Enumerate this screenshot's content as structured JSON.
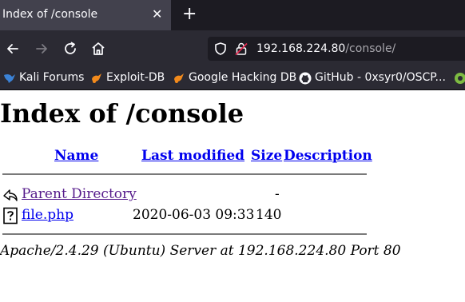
{
  "browser": {
    "tab_title": "Index of /console",
    "tab_close": "✕",
    "new_tab": "+",
    "url": {
      "host": "192.168.224.80",
      "path": "/console/"
    },
    "bookmarks": [
      {
        "label": "Kali Forums",
        "icon": "kali-icon"
      },
      {
        "label": "Exploit-DB",
        "icon": "exploit-db-icon"
      },
      {
        "label": "Google Hacking DB",
        "icon": "exploit-db-icon"
      },
      {
        "label": "GitHub - 0xsyr0/OSCP...",
        "icon": "github-icon"
      }
    ]
  },
  "page": {
    "heading": "Index of /console",
    "columns": {
      "name": "Name",
      "last_modified": "Last modified",
      "size": "Size",
      "description": "Description"
    },
    "rows": [
      {
        "name": "Parent Directory",
        "last_modified": "",
        "size": "-",
        "description": "",
        "icon": "back-folder-icon"
      },
      {
        "name": "file.php",
        "last_modified": "2020-06-03 09:33",
        "size": "140",
        "description": "",
        "icon": "unknown-file-icon"
      }
    ],
    "address": "Apache/2.4.29 (Ubuntu) Server at 192.168.224.80 Port 80"
  }
}
